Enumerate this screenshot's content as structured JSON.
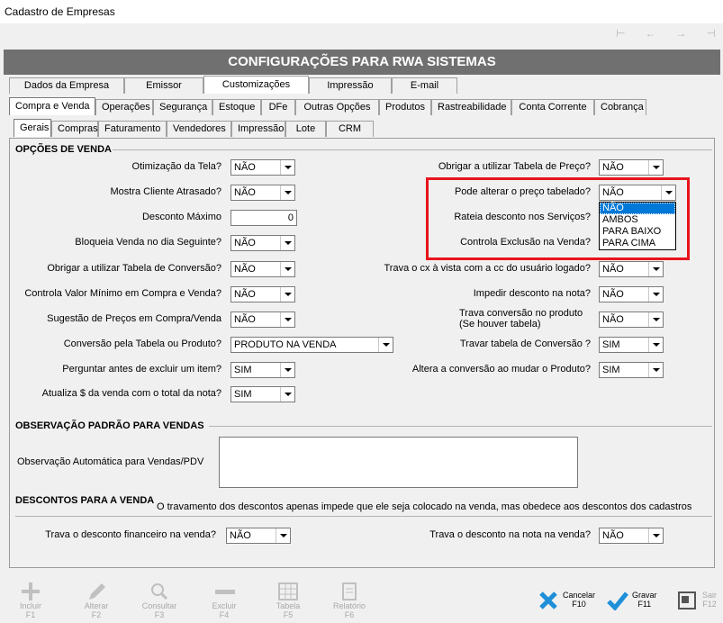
{
  "window": {
    "title": "Cadastro de Empresas"
  },
  "nav": [
    "⊢",
    "←",
    "→",
    "⊣"
  ],
  "header": {
    "title": "CONFIGURAÇÕES PARA RWA SISTEMAS"
  },
  "tabs_main": [
    "Dados da Empresa",
    "Emissor",
    "Customizações",
    "Impressão",
    "E-mail"
  ],
  "tabs_main_active": "Customizações",
  "tabs_sub": [
    "Compra e Venda",
    "Operações",
    "Segurança",
    "Estoque",
    "DFe",
    "Outras Opções",
    "Produtos",
    "Rastreabilidade",
    "Conta Corrente",
    "Cobrança"
  ],
  "tabs_sub2": [
    "Gerais",
    "Compras",
    "Faturamento",
    "Vendedores",
    "Impressão",
    "Lote",
    "CRM"
  ],
  "opcoes": {
    "title": "OPÇÕES DE VENDA",
    "left": [
      {
        "label": "Otimização da Tela?",
        "value": "NÃO"
      },
      {
        "label": "Mostra Cliente Atrasado?",
        "value": "NÃO"
      },
      {
        "label": "Desconto Máximo",
        "value": "0"
      },
      {
        "label": "Bloqueia Venda no dia Seguinte?",
        "value": "NÃO"
      },
      {
        "label": "Obrigar a utilizar Tabela de Conversão?",
        "value": "NÃO"
      },
      {
        "label": "Controla Valor Mínimo em Compra e Venda?",
        "value": "NÃO"
      },
      {
        "label": "Sugestão de Preços em Compra/Venda",
        "value": "NÃO"
      },
      {
        "label": "Conversão pela Tabela ou Produto?",
        "value": "PRODUTO NA VENDA"
      },
      {
        "label": "Perguntar antes de excluir um item?",
        "value": "SIM"
      },
      {
        "label": "Atualiza $ da venda com o total da nota?",
        "value": "SIM"
      }
    ],
    "right": [
      {
        "label": "Obrigar a utilizar Tabela de Preço?",
        "value": "NÃO"
      },
      {
        "label": "Pode alterar o preço tabelado?",
        "value": "NÃO"
      },
      {
        "label": "Rateia desconto nos Serviços?",
        "value": ""
      },
      {
        "label": "Controla Exclusão na Venda?",
        "value": ""
      },
      {
        "label": "Trava o cx à vista com a cc do usuário logado?",
        "value": "NÃO"
      },
      {
        "label": "Impedir desconto na nota?",
        "value": "NÃO"
      },
      {
        "label": "Trava conversão no produto",
        "label2": "(Se houver tabela)",
        "value": "NÃO"
      },
      {
        "label": "Travar tabela de Conversão ?",
        "value": "SIM"
      },
      {
        "label": "Altera a conversão ao mudar o Produto?",
        "value": "SIM"
      }
    ],
    "dropdown_options": [
      "NÃO",
      "AMBOS",
      "PARA BAIXO",
      "PARA CIMA"
    ]
  },
  "observacao": {
    "title": "OBSERVAÇÃO PADRÃO PARA VENDAS",
    "label": "Observação Automática para Vendas/PDV",
    "value": ""
  },
  "descontos": {
    "title": "DESCONTOS PARA A VENDA",
    "note": "O travamento dos descontos apenas impede que ele seja colocado na venda, mas obedece aos descontos dos cadastros",
    "financeiro_label": "Trava o desconto financeiro na venda?",
    "financeiro_value": "NÃO",
    "nota_label": "Trava o desconto na nota na venda?",
    "nota_value": "NÃO"
  },
  "toolbar": [
    {
      "label": "Incluir",
      "key": "F1"
    },
    {
      "label": "Alterar",
      "key": "F2"
    },
    {
      "label": "Consultar",
      "key": "F3"
    },
    {
      "label": "Excluir",
      "key": "F4"
    },
    {
      "label": "Tabela",
      "key": "F5"
    },
    {
      "label": "Relatório",
      "key": "F6"
    },
    {
      "label": "Cancelar",
      "key": "F10"
    },
    {
      "label": "Gravar",
      "key": "F11"
    },
    {
      "label": "Sair",
      "key": "F12"
    }
  ]
}
